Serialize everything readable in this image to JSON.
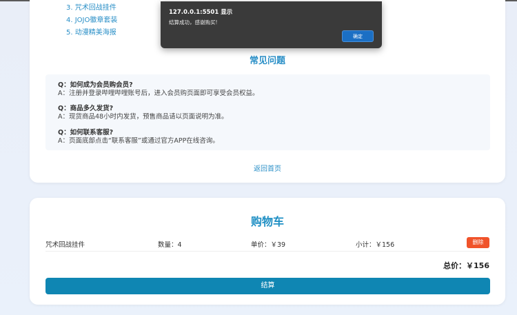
{
  "tips": {
    "items": [
      "3. 咒术回战挂件",
      "4. JOJO徽章套装",
      "5. 动漫精美海报"
    ]
  },
  "faq": {
    "title": "常见问题",
    "items": [
      {
        "q": "Q：如何成为会员购会员?",
        "a": "A：注册并登录哔哩哔哩账号后，进入会员购页面即可享受会员权益。"
      },
      {
        "q": "Q：商品多久发货?",
        "a": "A：现货商品48小时内发货，预售商品请以页面说明为准。"
      },
      {
        "q": "Q：如何联系客服?",
        "a": "A：页面底部点击“联系客服”或通过官方APP在线咨询。"
      }
    ],
    "back_home": "返回首页"
  },
  "cart": {
    "title": "购物车",
    "row": {
      "name": "咒术回战挂件",
      "quantity": "数量：4",
      "unit_price": "单价：￥39",
      "subtotal": "小计：￥156",
      "delete_label": "删除"
    },
    "total": "总价：￥156",
    "checkout_label": "结算"
  },
  "dialog": {
    "title": "127.0.0.1:5501 显示",
    "message": "结算成功，感谢购买!",
    "ok_label": "确定"
  },
  "colors": {
    "accent": "#2a8fc7",
    "checkout": "#0f86b3",
    "delete": "#f0532a",
    "dialog_bg": "#3a3a3a",
    "dialog_button": "#1b6fc4"
  }
}
